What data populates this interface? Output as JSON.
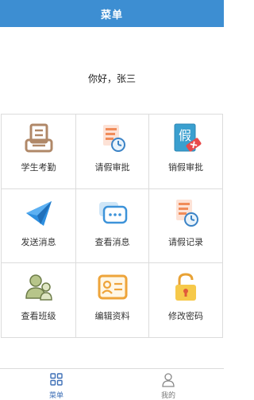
{
  "header": {
    "title": "菜单"
  },
  "greeting": "你好，张三",
  "menu": {
    "items": [
      {
        "label": "学生考勤",
        "icon": "printer-attendance-icon"
      },
      {
        "label": "请假审批",
        "icon": "document-clock-icon"
      },
      {
        "label": "销假审批",
        "icon": "leave-cancel-icon"
      },
      {
        "label": "发送消息",
        "icon": "paper-plane-icon"
      },
      {
        "label": "查看消息",
        "icon": "chat-bubble-icon"
      },
      {
        "label": "请假记录",
        "icon": "document-clock-icon"
      },
      {
        "label": "查看班级",
        "icon": "users-icon"
      },
      {
        "label": "编辑资料",
        "icon": "id-card-icon"
      },
      {
        "label": "修改密码",
        "icon": "padlock-icon"
      }
    ]
  },
  "footer": {
    "tabs": [
      {
        "label": "菜单",
        "icon": "grid-icon"
      },
      {
        "label": "我的",
        "icon": "user-icon"
      }
    ]
  }
}
